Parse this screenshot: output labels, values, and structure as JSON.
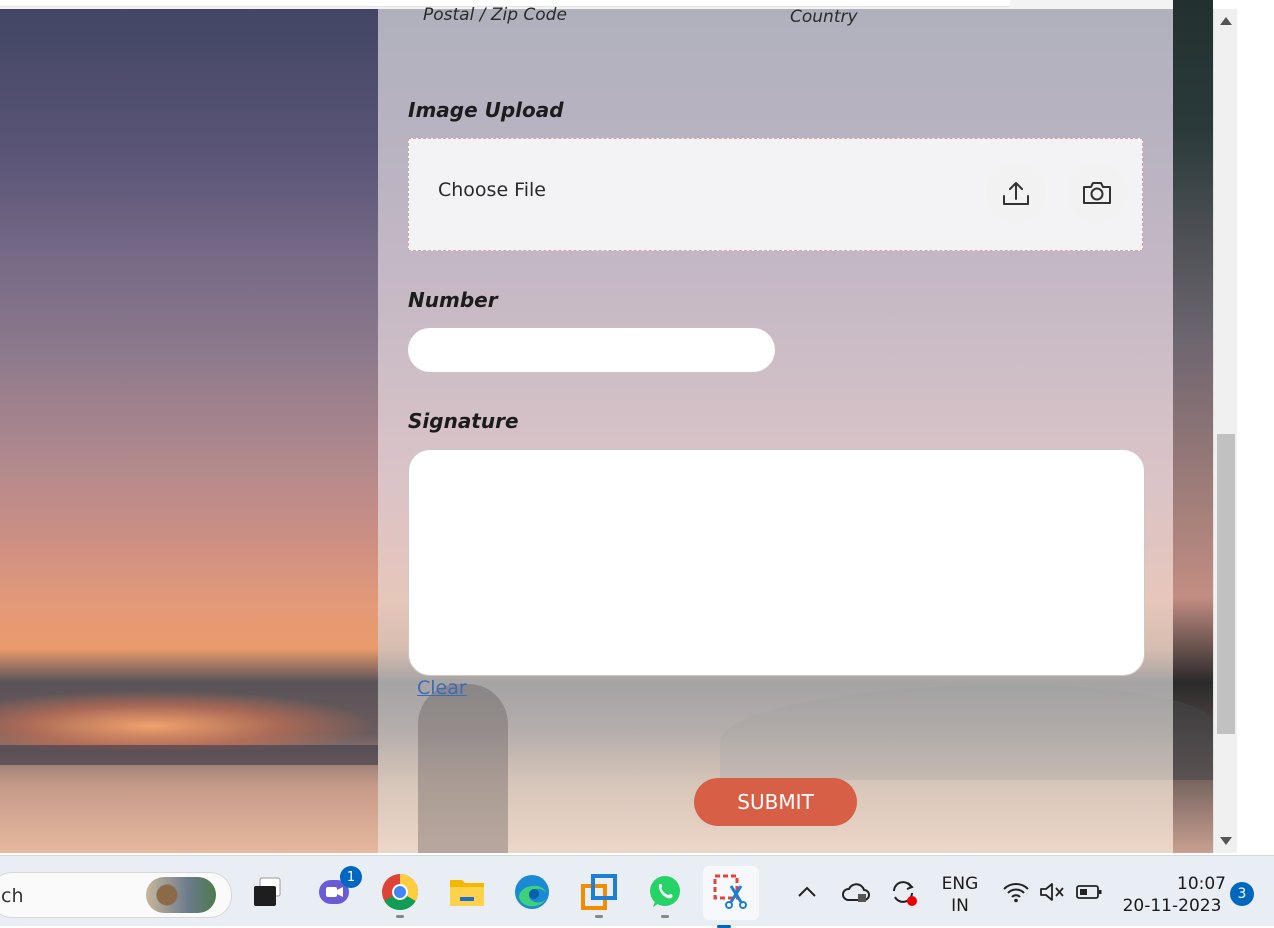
{
  "form": {
    "postal_label": "Postal / Zip Code",
    "country_label": "Country",
    "image_upload_label": "Image Upload",
    "choose_file": "Choose File",
    "number_label": "Number",
    "number_value": "",
    "signature_label": "Signature",
    "clear_link": "Clear",
    "submit_label": "SUBMIT"
  },
  "taskbar": {
    "search_text": "ch",
    "video_badge": "1",
    "language_line1": "ENG",
    "language_line2": "IN",
    "time": "10:07",
    "date": "20-11-2023",
    "notification_count": "3"
  },
  "colors": {
    "submit": "#d65f45",
    "link": "#3c6bb7",
    "accent": "#0067c0"
  }
}
